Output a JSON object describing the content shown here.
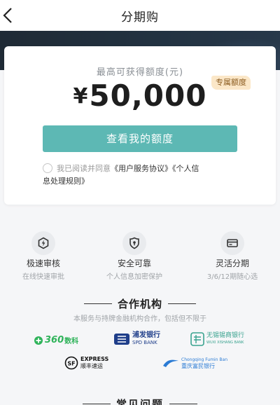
{
  "header": {
    "title": "分期购"
  },
  "card": {
    "limit_label": "最高可获得额度(元)",
    "currency": "¥",
    "amount": "50,000",
    "badge": "专属额度",
    "button": "查看我的额度",
    "agreement_prefix": "我已阅读并同意",
    "agreement_link1": "《用户服务协议》",
    "agreement_link2a": "《个人信",
    "agreement_link2b": "息处理规则》"
  },
  "features": [
    {
      "title": "极速审核",
      "subtitle": "在线快速审批",
      "icon": "lightning-icon"
    },
    {
      "title": "安全可靠",
      "subtitle": "个人信息加密保护",
      "icon": "shield-icon"
    },
    {
      "title": "灵活分期",
      "subtitle": "3/6/12期随心选",
      "icon": "card-icon"
    }
  ],
  "partners": {
    "title": "合作机构",
    "description": "本服务与持牌金融机构合作，包括但不限于",
    "logos": {
      "l360_num": "360",
      "l360_text": "数科",
      "spd_cn": "浦发银行",
      "spd_en": "SPD BANK",
      "wuxi_cn": "无锡锡商银行",
      "wuxi_en": "WUXI XISHANG BANK",
      "sf_en": "EXPRESS",
      "sf_cn": "顺丰速运",
      "cq_en": "Chongqing Fumin Ban",
      "cq_cn": "重庆富民银行"
    }
  },
  "faq": {
    "title": "常见问题"
  },
  "colors": {
    "accent": "#5db8b4",
    "banner": "#223241",
    "badge_bg": "#fbe7c8"
  }
}
